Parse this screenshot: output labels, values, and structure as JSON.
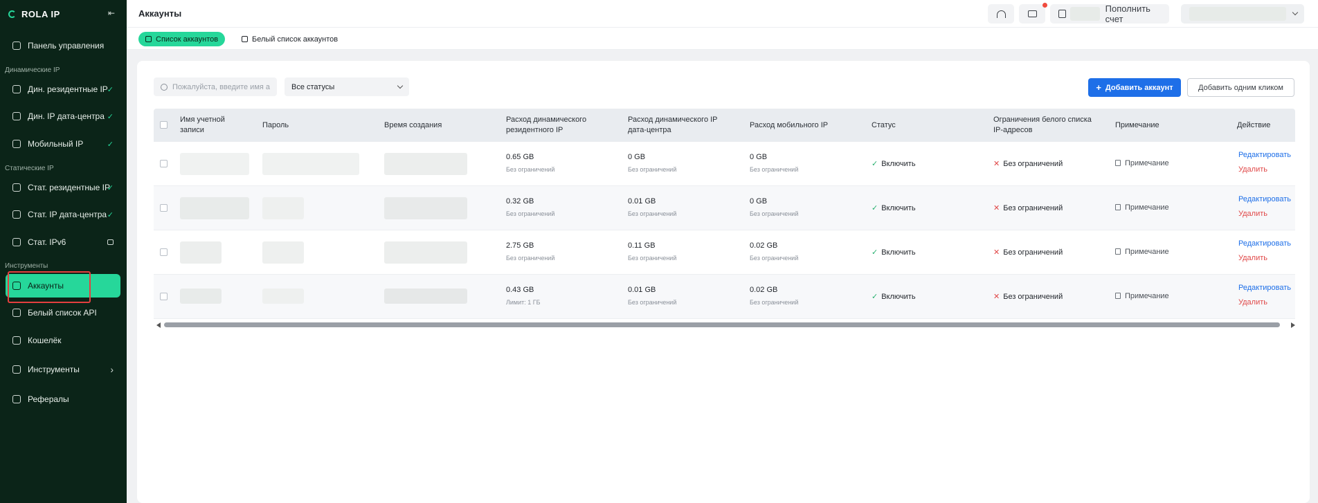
{
  "brand": {
    "name": "ROLA IP"
  },
  "sidebar": {
    "items": [
      {
        "label": "Панель управления",
        "right": ""
      },
      {
        "label": "Дин. резидентные IP",
        "right": "✓"
      },
      {
        "label": "Дин. IP дата-центра",
        "right": "✓"
      },
      {
        "label": "Мобильный IP",
        "right": "✓"
      },
      {
        "label": "Стат. резидентные IP",
        "right": "✓"
      },
      {
        "label": "Стат. IP дата-центра",
        "right": "✓"
      },
      {
        "label": "Стат. IPv6",
        "right": ""
      },
      {
        "label": "Аккаунты",
        "right": ""
      },
      {
        "label": "Белый список API",
        "right": ""
      },
      {
        "label": "Кошелёк",
        "right": ""
      },
      {
        "label": "Инструменты",
        "right": "›"
      },
      {
        "label": "Рефералы",
        "right": ""
      }
    ],
    "sections": {
      "dynamic": "Динамические IP",
      "static": "Статические IP",
      "tools": "Инструменты"
    }
  },
  "header": {
    "title": "Аккаунты",
    "topup_label": "Пополнить счет"
  },
  "tabs": [
    {
      "label": "Список аккаунтов"
    },
    {
      "label": "Белый список аккаунтов"
    }
  ],
  "toolbar": {
    "search_placeholder": "Пожалуйста, введите имя а",
    "status_select": "Все статусы",
    "add_account": "Добавить аккаунт",
    "add_one_click": "Добавить одним кликом"
  },
  "table": {
    "columns": [
      "Имя учетной записи",
      "Пароль",
      "Время создания",
      "Расход динамического резидентного IP",
      "Расход динамического IP дата-центра",
      "Расход мобильного IP",
      "Статус",
      "Ограничения белого списка IP-адресов",
      "Примечание",
      "Действие"
    ],
    "rows": [
      {
        "res": "0.65 GB",
        "res_sub": "Без ограничений",
        "dc": "0 GB",
        "dc_sub": "Без ограничений",
        "mob": "0 GB",
        "mob_sub": "Без ограничений",
        "status": "Включить",
        "whitelist": "Без ограничений",
        "note": "Примечание",
        "edit": "Редактировать",
        "delete": "Удалить"
      },
      {
        "res": "0.32 GB",
        "res_sub": "Без ограничений",
        "dc": "0.01 GB",
        "dc_sub": "Без ограничений",
        "mob": "0 GB",
        "mob_sub": "Без ограничений",
        "status": "Включить",
        "whitelist": "Без ограничений",
        "note": "Примечание",
        "edit": "Редактировать",
        "delete": "Удалить"
      },
      {
        "res": "2.75 GB",
        "res_sub": "Без ограничений",
        "dc": "0.11 GB",
        "dc_sub": "Без ограничений",
        "mob": "0.02 GB",
        "mob_sub": "Без ограничений",
        "status": "Включить",
        "whitelist": "Без ограничений",
        "note": "Примечание",
        "edit": "Редактировать",
        "delete": "Удалить"
      },
      {
        "res": "0.43 GB",
        "res_sub": "Лимит: 1 ГБ",
        "dc": "0.01 GB",
        "dc_sub": "Без ограничений",
        "mob": "0.02 GB",
        "mob_sub": "Без ограничений",
        "status": "Включить",
        "whitelist": "Без ограничений",
        "note": "Примечание",
        "edit": "Редактировать",
        "delete": "Удалить"
      }
    ]
  },
  "colors": {
    "accent": "#26d79a",
    "sidebar_bg": "#0b2418",
    "primary": "#1e6fe8",
    "danger": "#e04848"
  }
}
